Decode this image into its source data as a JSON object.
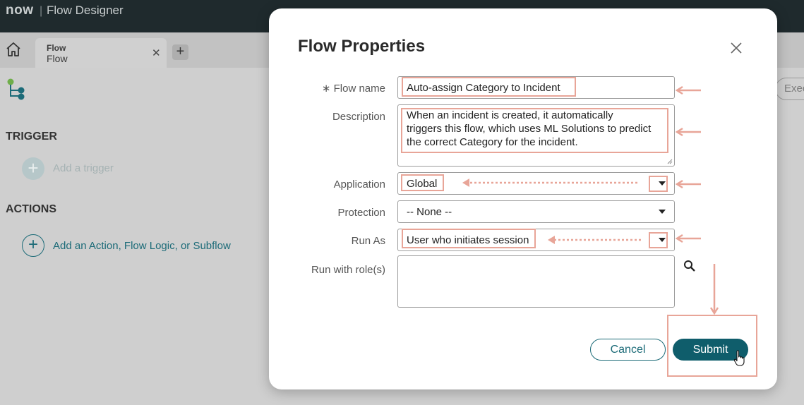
{
  "app": {
    "brand": "now",
    "title": "Flow Designer"
  },
  "tabs": [
    {
      "title": "Flow",
      "subtitle": "Flow"
    }
  ],
  "toolbar": {
    "execution_label": "Execution"
  },
  "left_panel": {
    "trigger_heading": "TRIGGER",
    "add_trigger_label": "Add a trigger",
    "actions_heading": "ACTIONS",
    "add_action_label": "Add an Action, Flow Logic, or Subflow"
  },
  "modal": {
    "title": "Flow Properties",
    "fields": {
      "flow_name": {
        "label": "∗ Flow name",
        "value": "Auto-assign Category to Incident"
      },
      "description": {
        "label": "Description",
        "lines": [
          "When an incident is created, it automatically",
          "triggers this flow, which uses ML Solutions to predict",
          "the correct Category for the incident."
        ]
      },
      "application": {
        "label": "Application",
        "value": "Global"
      },
      "protection": {
        "label": "Protection",
        "value": "-- None --"
      },
      "run_as": {
        "label": "Run As",
        "value": "User who initiates session"
      },
      "run_with_roles": {
        "label": "Run with role(s)",
        "value": ""
      }
    },
    "cancel_label": "Cancel",
    "submit_label": "Submit"
  },
  "colors": {
    "topbar": "#1f2a2d",
    "accent": "#0f5d6b",
    "highlight": "#e8a598",
    "link": "#1c6b78"
  },
  "icons": [
    "home-icon",
    "close-icon",
    "add-icon",
    "flow-icon",
    "chevron-down-icon",
    "search-icon",
    "hand-pointer-icon",
    "plus-circle-icon"
  ]
}
